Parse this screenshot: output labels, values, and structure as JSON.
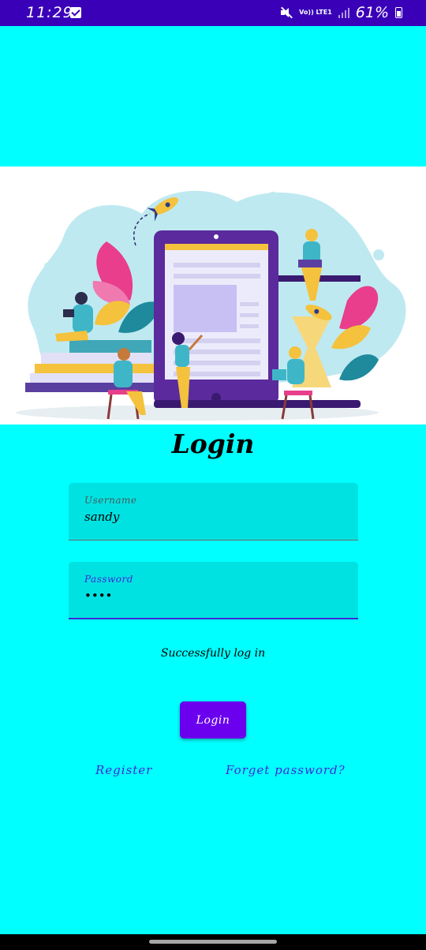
{
  "status_bar": {
    "time": "11:29",
    "network_label": "Vo)) LTE1",
    "battery_percent": "61%",
    "battery_level": 0.61,
    "icons": [
      "checkbox-notification-icon",
      "mute-icon",
      "signal-icon",
      "battery-icon"
    ]
  },
  "illustration": {
    "icon": "people-working-on-tablet-illustration"
  },
  "form": {
    "title": "Login",
    "username": {
      "label": "Username",
      "value": "sandy"
    },
    "password": {
      "label": "Password",
      "value": "••••"
    },
    "status_message": "Successfully log in",
    "login_button": "Login",
    "register_link": "Register",
    "forget_link": "Forget password?"
  },
  "colors": {
    "background": "#00FFFF",
    "status_bar": "#3A00B8",
    "field_fill": "#00E2E2",
    "accent": "#6A00EE",
    "link": "#3F2BD6"
  }
}
